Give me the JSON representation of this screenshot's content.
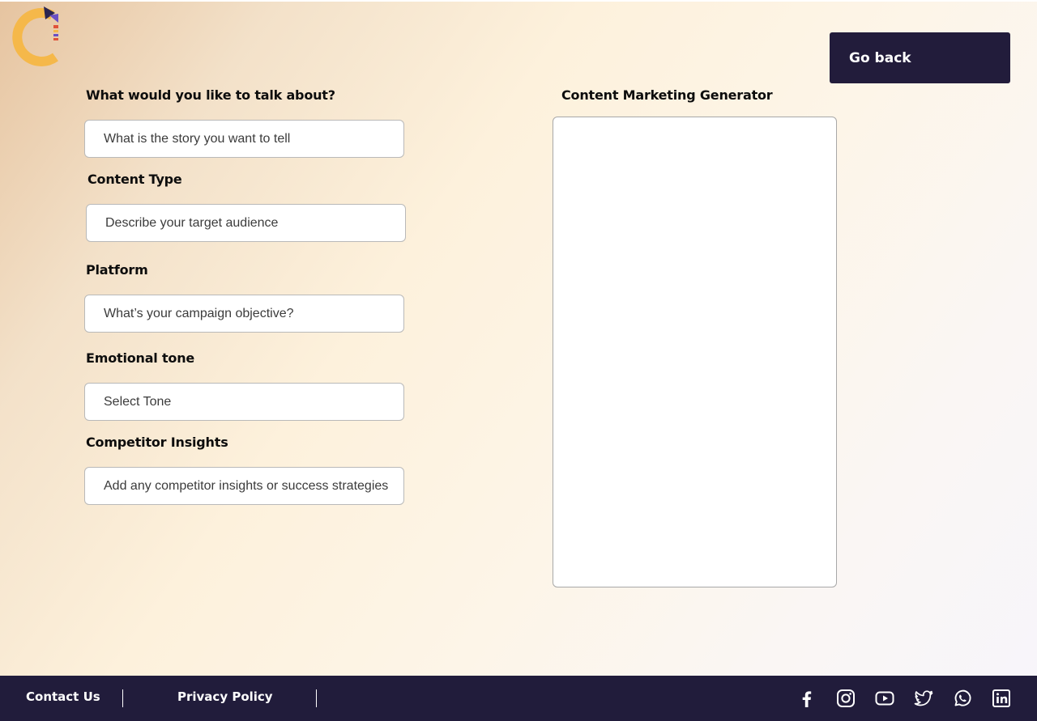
{
  "header": {
    "back_label": "Go back"
  },
  "form": {
    "topic": {
      "label": "What would you like to talk about?",
      "placeholder": "What is the story you want to tell"
    },
    "content_type": {
      "label": "Content Type",
      "placeholder": "Describe your target audience"
    },
    "platform": {
      "label": "Platform",
      "placeholder": "What’s your campaign objective?"
    },
    "tone": {
      "label": "Emotional tone",
      "placeholder": "Select Tone"
    },
    "competitor": {
      "label": "Competitor Insights",
      "placeholder": "Add any competitor insights or success strategies"
    }
  },
  "output": {
    "title": "Content Marketing Generator",
    "value": ""
  },
  "footer": {
    "contact_label": "Contact Us",
    "privacy_label": "Privacy Policy",
    "social_icons": [
      "facebook-icon",
      "instagram-icon",
      "youtube-icon",
      "twitter-icon",
      "whatsapp-icon",
      "linkedin-icon"
    ]
  },
  "colors": {
    "brand_dark": "#221c3b",
    "logo_orange": "#f5b84a",
    "logo_navy": "#2b2550",
    "logo_purple": "#6a4fc4",
    "logo_red": "#e0523a"
  }
}
